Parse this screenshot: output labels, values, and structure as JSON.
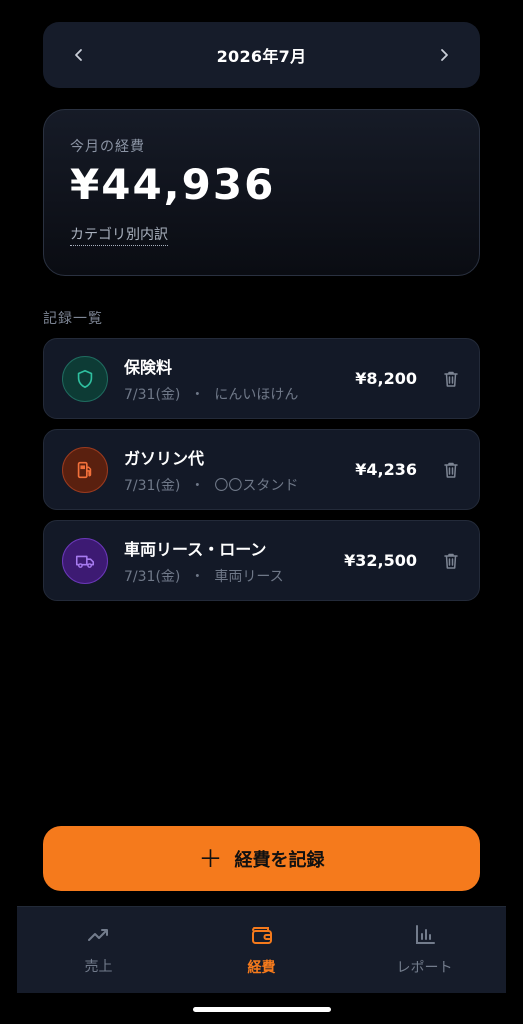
{
  "header": {
    "month_title": "2026年7月",
    "prev_icon": "chevron-left-icon",
    "next_icon": "chevron-right-icon"
  },
  "summary": {
    "label": "今月の経費",
    "amount": "¥44,936",
    "breakdown_link": "カテゴリ別内訳"
  },
  "records": {
    "section_title": "記録一覧",
    "items": [
      {
        "title": "保険料",
        "date": "7/31(金)",
        "separator": "・",
        "vendor": "にんいほけん",
        "amount": "¥8,200",
        "icon": "shield-icon",
        "icon_color": "#2fbf9f"
      },
      {
        "title": "ガソリン代",
        "date": "7/31(金)",
        "separator": "・",
        "vendor": "〇〇スタンド",
        "amount": "¥4,236",
        "icon": "fuel-pump-icon",
        "icon_color": "#f2703a"
      },
      {
        "title": "車両リース・ローン",
        "date": "7/31(金)",
        "separator": "・",
        "vendor": "車両リース",
        "amount": "¥32,500",
        "icon": "truck-icon",
        "icon_color": "#a77bf0"
      }
    ]
  },
  "action": {
    "record_button_label": "経費を記録",
    "record_button_icon": "plus-icon"
  },
  "tabs": [
    {
      "label": "売上",
      "icon": "trending-up-icon",
      "active": false
    },
    {
      "label": "経費",
      "icon": "wallet-icon",
      "active": true
    },
    {
      "label": "レポート",
      "icon": "bar-chart-icon",
      "active": false
    }
  ],
  "colors": {
    "accent": "#f57a1c",
    "card_bg": "#131927",
    "bar_bg": "#161c2a"
  }
}
